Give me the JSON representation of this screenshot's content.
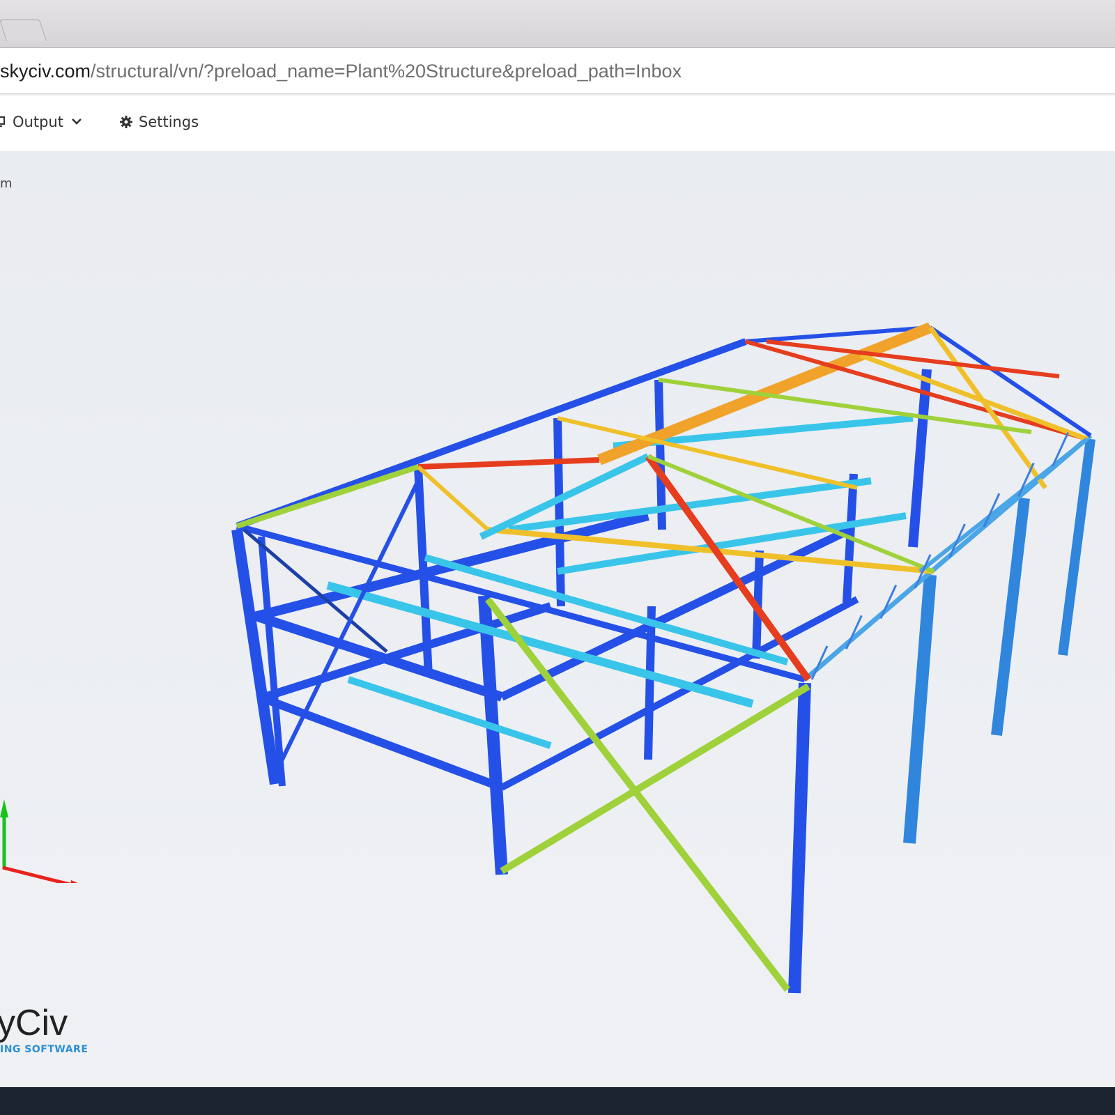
{
  "browser": {
    "url_domain": "skyciv.com",
    "url_path": "/structural/vn/?preload_name=Plant%20Structure&preload_path=Inbox"
  },
  "toolbar": {
    "output_label": "Output",
    "output_icon": "monitor-icon",
    "settings_label": "Settings",
    "settings_icon": "gear-icon"
  },
  "viewport": {
    "unit_label": "m",
    "axes": {
      "x_color": "#e8221c",
      "y_color": "#17c21b"
    }
  },
  "logo": {
    "name": "yCiv",
    "tagline": "ING SOFTWARE"
  },
  "colors": {
    "low": "#2550e8",
    "cool": "#39c5ea",
    "mid": "#9fd13a",
    "warm": "#f0c02a",
    "high": "#e53d1e",
    "bottom_bar": "#1c2430"
  }
}
